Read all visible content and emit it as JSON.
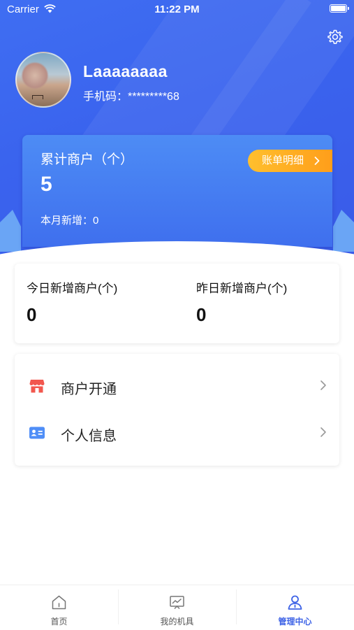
{
  "status_bar": {
    "carrier": "Carrier",
    "time": "11:22 PM"
  },
  "profile": {
    "name": "Laaaaaaaa",
    "phone": "手机码：*********68"
  },
  "summary": {
    "title": "累计商户（个）",
    "value": "5",
    "month_new": "本月新增：0",
    "bill_button": "账单明细"
  },
  "stats": {
    "today_label": "今日新增商户(个)",
    "today_value": "0",
    "yesterday_label": "昨日新增商户(个)",
    "yesterday_value": "0"
  },
  "menu": {
    "items": [
      {
        "label": "商户开通",
        "icon": "store-icon"
      },
      {
        "label": "个人信息",
        "icon": "id-card-icon"
      }
    ]
  },
  "tabbar": {
    "items": [
      {
        "label": "首页",
        "icon": "home-icon"
      },
      {
        "label": "我的机具",
        "icon": "chart-icon"
      },
      {
        "label": "管理中心",
        "icon": "user-icon",
        "active": true
      }
    ]
  },
  "colors": {
    "primary": "#3e63e6",
    "hero_blue": "#3a63ee",
    "card_blue": "#4d8cf5",
    "accent_orange": "#ffab22",
    "store_red": "#f2574e",
    "id_blue": "#4f8ef7"
  }
}
